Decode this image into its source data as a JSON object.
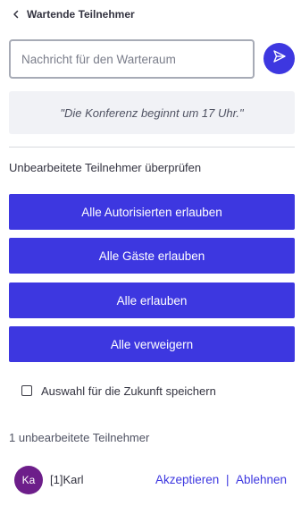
{
  "header": {
    "back_icon": "chevron-left-icon",
    "title": "Wartende Teilnehmer"
  },
  "message": {
    "placeholder": "Nachricht für den Warteraum",
    "value": "",
    "send_icon": "send-arrow-icon"
  },
  "notice": {
    "text": "\"Die Konferenz beginnt um 17 Uhr.\""
  },
  "review": {
    "label": "Unbearbeitete Teilnehmer überprüfen",
    "buttons": [
      {
        "label": "Alle Autorisierten erlauben"
      },
      {
        "label": "Alle Gäste erlauben"
      },
      {
        "label": "Alle erlauben"
      },
      {
        "label": "Alle verweigern"
      }
    ]
  },
  "remember": {
    "label": "Auswahl für die Zukunft speichern",
    "checked": false
  },
  "participants": {
    "count_label": "1 unbearbeitete Teilnehmer",
    "items": [
      {
        "initials": "Ka",
        "name": "[1]Karl",
        "accept_label": "Akzeptieren",
        "separator": "|",
        "reject_label": "Ablehnen"
      }
    ]
  },
  "colors": {
    "accent": "#3d37e0",
    "avatar": "#6d1e8a",
    "notice_bg": "#f1f2f6"
  }
}
